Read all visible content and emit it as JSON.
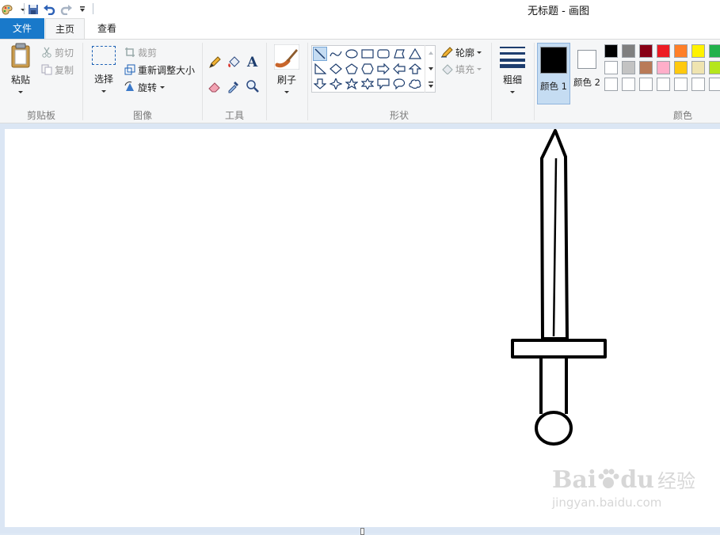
{
  "window": {
    "title": "无标题 - 画图"
  },
  "tabs": {
    "file": "文件",
    "home": "主页",
    "view": "查看"
  },
  "clipboard": {
    "paste": "粘贴",
    "cut": "剪切",
    "copy": "复制",
    "group": "剪贴板"
  },
  "image": {
    "select": "选择",
    "crop": "裁剪",
    "resize": "重新调整大小",
    "rotate": "旋转",
    "group": "图像"
  },
  "tools": {
    "group": "工具"
  },
  "brushes": {
    "label": "刷子"
  },
  "shapes": {
    "outline": "轮廓",
    "fill": "填充",
    "group": "形状"
  },
  "size": {
    "label": "粗细"
  },
  "colors": {
    "color1": "颜色 1",
    "color2": "颜色 2",
    "group": "颜色",
    "color1_value": "#000000",
    "color2_value": "#ffffff",
    "palette_row1": [
      "#000000",
      "#7f7f7f",
      "#880015",
      "#ed1c24",
      "#ff7f27",
      "#fff200",
      "#22b14c"
    ],
    "palette_row2": [
      "#ffffff",
      "#c3c3c3",
      "#b97a57",
      "#ffaec9",
      "#ffc90e",
      "#efe4b0",
      "#b5e61d"
    ],
    "palette_row3": [
      "#ffffff",
      "#ffffff",
      "#ffffff",
      "#ffffff",
      "#ffffff",
      "#ffffff",
      "#ffffff"
    ]
  },
  "watermark": {
    "brand": "Bai",
    "brand2": "du",
    "cn": "经验",
    "url": "jingyan.baidu.com"
  }
}
